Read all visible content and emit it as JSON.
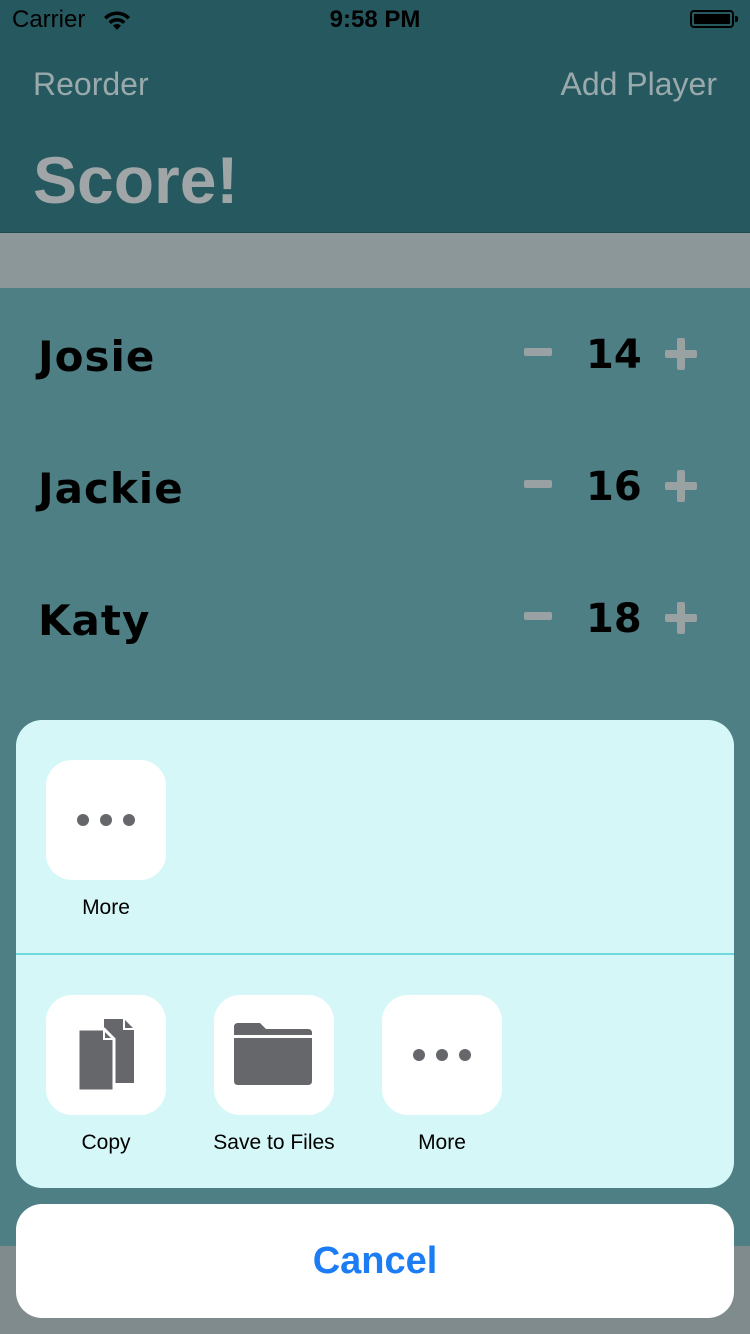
{
  "status": {
    "carrier": "Carrier",
    "time": "9:58 PM"
  },
  "nav": {
    "left_label": "Reorder",
    "right_label": "Add Player",
    "title": "Score!"
  },
  "players": [
    {
      "name": "Josie",
      "score": "14"
    },
    {
      "name": "Jackie",
      "score": "16"
    },
    {
      "name": "Katy",
      "score": "18"
    }
  ],
  "share": {
    "row1": [
      {
        "label": "More",
        "icon": "more-icon"
      }
    ],
    "row2": [
      {
        "label": "Copy",
        "icon": "copy-icon"
      },
      {
        "label": "Save to Files",
        "icon": "folder-icon"
      },
      {
        "label": "More",
        "icon": "more-icon"
      }
    ],
    "cancel_label": "Cancel"
  },
  "colors": {
    "nav_bg": "#26585f",
    "list_bg": "#4d7f84",
    "sheet_bg": "#d6f7f7",
    "accent": "#1b7cf4",
    "icon_gray": "#66676b"
  }
}
